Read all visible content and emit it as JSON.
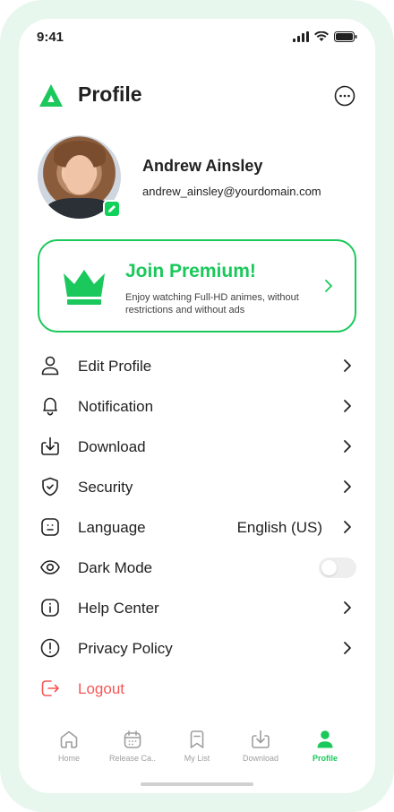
{
  "status_bar": {
    "time": "9:41"
  },
  "header": {
    "title": "Profile"
  },
  "user": {
    "name": "Andrew Ainsley",
    "email": "andrew_ainsley@yourdomain.com"
  },
  "premium": {
    "title": "Join Premium!",
    "description": "Enjoy watching Full-HD animes, without restrictions and without ads"
  },
  "menu": {
    "edit_profile": "Edit Profile",
    "notification": "Notification",
    "download": "Download",
    "security": "Security",
    "language": "Language",
    "language_value": "English (US)",
    "dark_mode": "Dark Mode",
    "dark_mode_on": false,
    "help_center": "Help Center",
    "privacy_policy": "Privacy Policy",
    "logout": "Logout"
  },
  "nav": {
    "home": "Home",
    "release_calendar": "Release Ca..",
    "my_list": "My List",
    "download": "Download",
    "profile": "Profile",
    "active": "profile"
  },
  "colors": {
    "accent": "#1ac85b",
    "danger": "#f75555",
    "text": "#212121",
    "muted": "#9e9e9e"
  },
  "icons": [
    "app-logo-icon",
    "more-icon",
    "edit-icon",
    "crown-icon",
    "chevron-right-icon",
    "user-icon",
    "bell-icon",
    "download-icon",
    "shield-icon",
    "language-icon",
    "eye-icon",
    "info-icon",
    "alert-icon",
    "logout-icon",
    "home-icon",
    "calendar-icon",
    "bookmark-icon",
    "profile-icon"
  ]
}
